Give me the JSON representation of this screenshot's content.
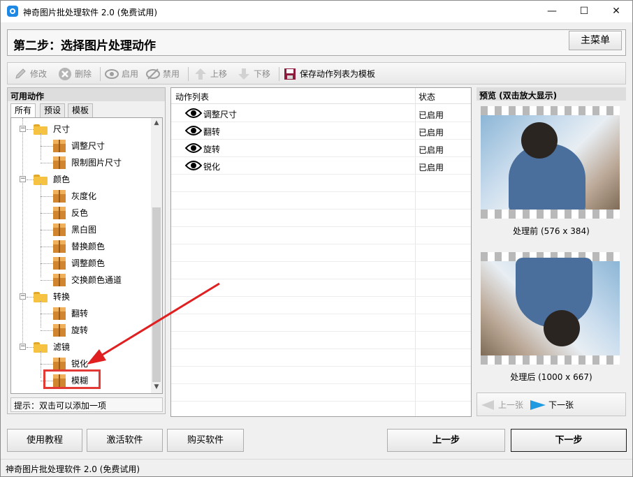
{
  "window": {
    "title": "神奇图片批处理软件 2.0 (免费试用)",
    "minimize": "—",
    "maximize": "☐",
    "close": "✕"
  },
  "header": {
    "title": "第二步：选择图片处理动作",
    "main_menu": "主菜单"
  },
  "toolbar": {
    "edit": "修改",
    "delete": "删除",
    "enable": "启用",
    "disable": "禁用",
    "move_up": "上移",
    "move_down": "下移",
    "save_template": "保存动作列表为模板"
  },
  "left": {
    "title": "可用动作",
    "tabs": [
      "所有",
      "预设",
      "模板"
    ],
    "tree": [
      {
        "label": "尺寸",
        "children": [
          "调整尺寸",
          "限制图片尺寸"
        ]
      },
      {
        "label": "颜色",
        "children": [
          "灰度化",
          "反色",
          "黑白图",
          "替换颜色",
          "调整颜色",
          "交换颜色通道"
        ]
      },
      {
        "label": "转换",
        "children": [
          "翻转",
          "旋转"
        ]
      },
      {
        "label": "滤镜",
        "children": [
          "锐化",
          "模糊"
        ]
      }
    ],
    "hint": "提示：双击可以添加一项"
  },
  "actions": {
    "col_name": "动作列表",
    "col_state": "状态",
    "rows": [
      {
        "name": "调整尺寸",
        "state": "已启用"
      },
      {
        "name": "翻转",
        "state": "已启用"
      },
      {
        "name": "旋转",
        "state": "已启用"
      },
      {
        "name": "锐化",
        "state": "已启用"
      }
    ]
  },
  "preview": {
    "title": "预览 (双击放大显示)",
    "before": "处理前 (576 x 384)",
    "after": "处理后 (1000 x 667)",
    "prev": "上一张",
    "next": "下一张"
  },
  "bottom": {
    "tutorial": "使用教程",
    "activate": "激活软件",
    "buy": "购买软件",
    "prev_step": "上一步",
    "next_step": "下一步"
  },
  "status": "神奇图片批处理软件 2.0 (免费试用)",
  "colors": {
    "accent": "#1e88e5",
    "folder": "#f6c242",
    "annotation": "#e53935"
  }
}
